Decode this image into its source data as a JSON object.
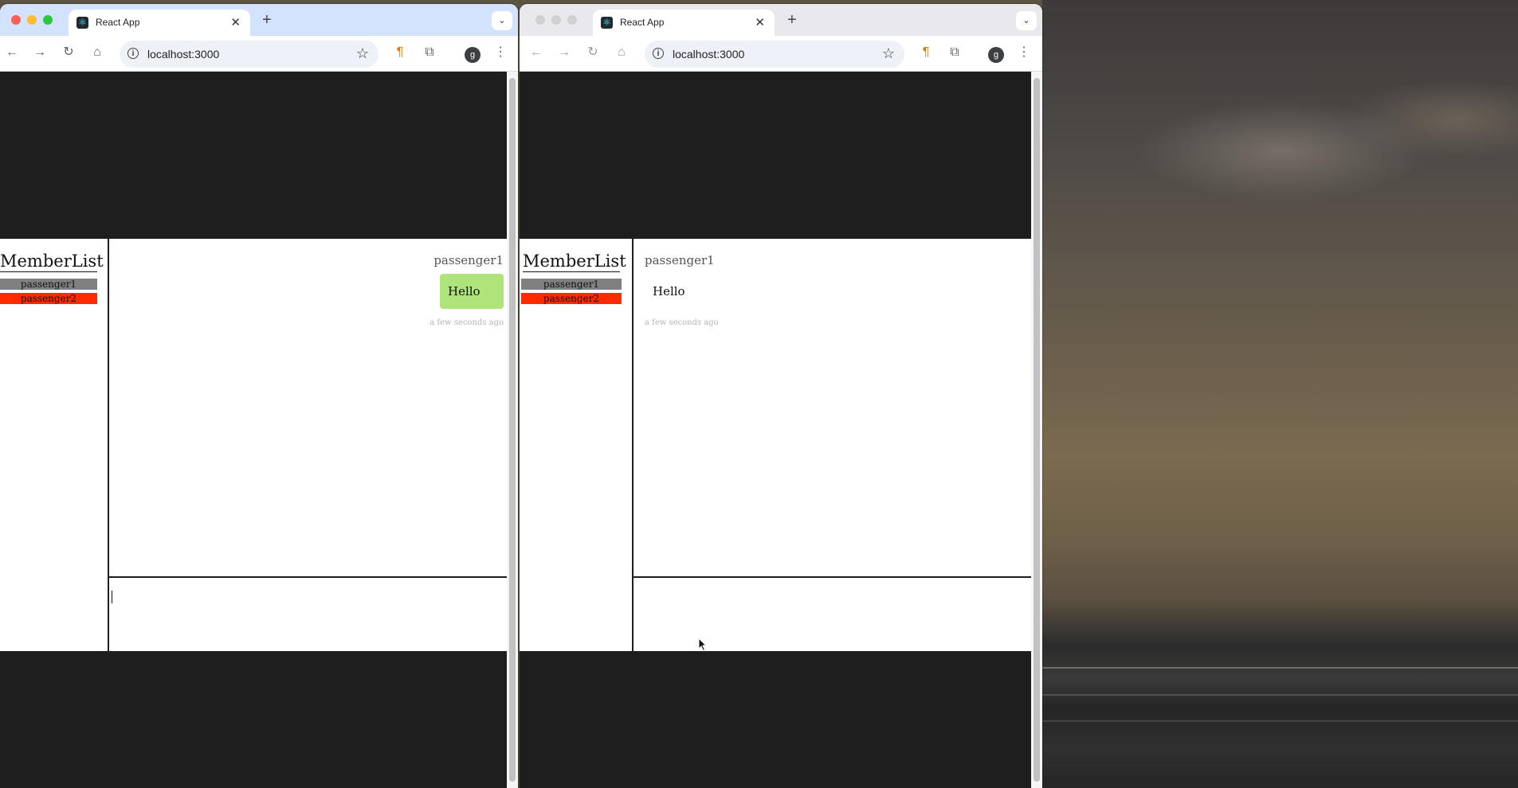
{
  "browsers": [
    {
      "tab_title": "React App",
      "url": "localhost:3000",
      "profile_initial": "g",
      "app": {
        "member_list_title": "MemberList",
        "members": [
          {
            "name": "passenger1",
            "color": "#808080"
          },
          {
            "name": "passenger2",
            "color": "#ff2a00"
          }
        ],
        "message": {
          "sender": "passenger1",
          "text": "Hello",
          "time": "a few seconds ago",
          "bubble_color": "#aee47a",
          "alignment": "right"
        }
      }
    },
    {
      "tab_title": "React App",
      "url": "localhost:3000",
      "profile_initial": "g",
      "app": {
        "member_list_title": "MemberList",
        "members": [
          {
            "name": "passenger1",
            "color": "#808080"
          },
          {
            "name": "passenger2",
            "color": "#ff2a00"
          }
        ],
        "message": {
          "sender": "passenger1",
          "text": "Hello",
          "time": "a few seconds ago",
          "bubble_color": "#ffffff",
          "alignment": "left"
        }
      }
    }
  ],
  "colors": {
    "page_background": "#1e1e1e",
    "active_tabstrip": "#d3e3fd",
    "inactive_tabstrip": "#e9e9ed"
  }
}
